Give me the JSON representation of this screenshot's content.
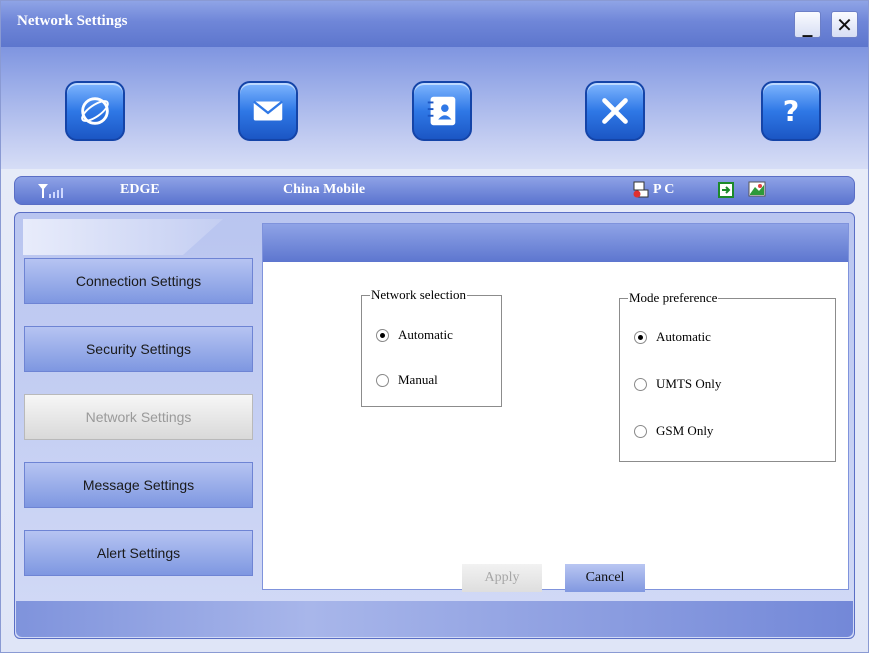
{
  "window": {
    "title": "Network Settings",
    "minimize_label": "_",
    "close_label": "✕"
  },
  "toolbar": {
    "items": [
      {
        "name": "internet-icon"
      },
      {
        "name": "message-icon"
      },
      {
        "name": "contacts-icon"
      },
      {
        "name": "settings-icon"
      },
      {
        "name": "help-icon"
      }
    ]
  },
  "status": {
    "network_type": "EDGE",
    "operator": "China Mobile",
    "device": "P C"
  },
  "sidebar": {
    "items": [
      {
        "label": "Connection Settings",
        "active": false
      },
      {
        "label": "Security Settings",
        "active": false
      },
      {
        "label": "Network Settings",
        "active": true
      },
      {
        "label": "Message Settings",
        "active": false
      },
      {
        "label": "Alert Settings",
        "active": false
      }
    ]
  },
  "network_selection": {
    "legend": "Network selection",
    "options": [
      {
        "label": "Automatic",
        "checked": true
      },
      {
        "label": "Manual",
        "checked": false
      }
    ]
  },
  "mode_preference": {
    "legend": "Mode preference",
    "options": [
      {
        "label": "Automatic",
        "checked": true
      },
      {
        "label": "UMTS Only",
        "checked": false
      },
      {
        "label": "GSM Only",
        "checked": false
      }
    ]
  },
  "buttons": {
    "apply": "Apply",
    "cancel": "Cancel"
  },
  "colors": {
    "accent": "#5d76cf",
    "toolbar_icon": "#2f78e6"
  }
}
